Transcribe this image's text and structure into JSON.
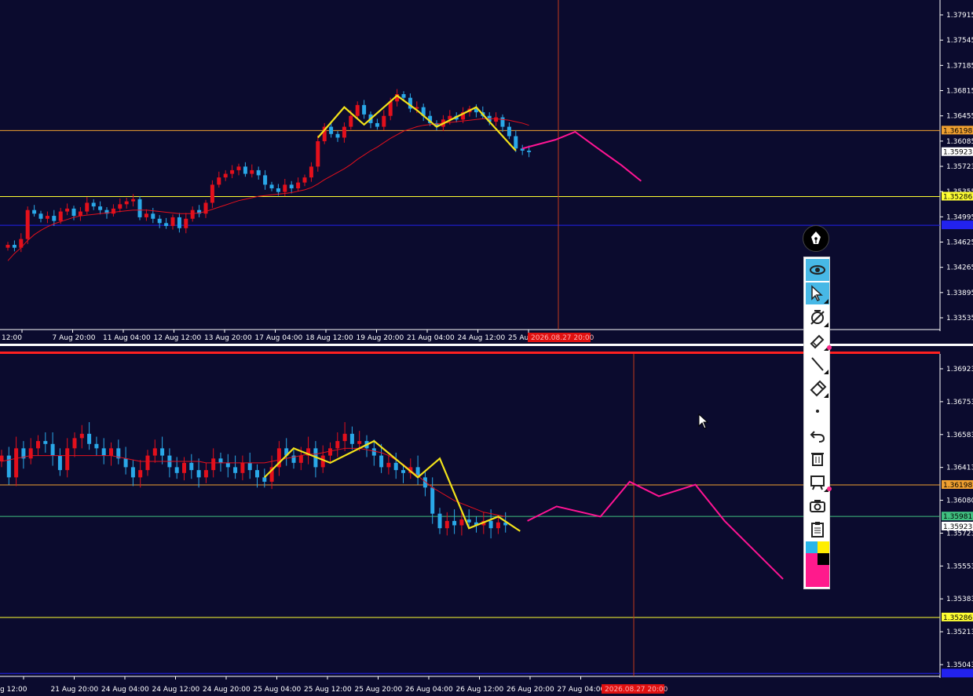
{
  "theme": {
    "background": "#0b0b2e",
    "bull_color": "#e3101c",
    "bear_color": "#2aa8e8",
    "ma_color": "#e3101c",
    "zigzag_color": "#f2e21a",
    "projection_color": "#ff1493",
    "hline_orange": "#f0a030",
    "hline_yellow": "#ffff33",
    "hline_blue": "#2222ee",
    "hline_green": "#40c080",
    "crosshair_color": "#c23a1a"
  },
  "chart_data": [
    {
      "type": "candlestick",
      "title": "",
      "x_tick_labels": [
        "12:00",
        "7 Aug 20:00",
        "11 Aug 04:00",
        "12 Aug 12:00",
        "13 Aug 20:00",
        "17 Aug 04:00",
        "18 Aug 12:00",
        "19 Aug 20:00",
        "21 Aug 04:00",
        "24 Aug 12:00",
        "25 Aug 20:00"
      ],
      "cursor_time_label": "2026.08.27 20:00",
      "y_tick_labels": [
        "1.37915",
        "1.37545",
        "1.37185",
        "1.36815",
        "1.36455",
        "1.36085",
        "1.35723",
        "1.35355",
        "1.34995",
        "1.34625",
        "1.34265",
        "1.33895",
        "1.33535"
      ],
      "ylim": [
        1.3345,
        1.38
      ],
      "horizontal_lines": [
        {
          "price": 1.36198,
          "label": "1.36198",
          "style": "orange"
        },
        {
          "price": 1.35286,
          "label": "1.35286",
          "style": "yellow"
        },
        {
          "price": 1.3489,
          "label": "",
          "style": "blue"
        }
      ],
      "current_price_label": "1.35923",
      "current_price": 1.35923,
      "closes": [
        1.3462,
        1.3458,
        1.347,
        1.351,
        1.3505,
        1.3498,
        1.3502,
        1.3495,
        1.3508,
        1.3512,
        1.3502,
        1.3508,
        1.352,
        1.3515,
        1.351,
        1.3505,
        1.3512,
        1.3518,
        1.3522,
        1.3525,
        1.35,
        1.3505,
        1.3498,
        1.3492,
        1.3488,
        1.35,
        1.3485,
        1.3498,
        1.351,
        1.3505,
        1.352,
        1.3545,
        1.3555,
        1.356,
        1.3565,
        1.357,
        1.356,
        1.3565,
        1.3558,
        1.3545,
        1.354,
        1.3535,
        1.3545,
        1.354,
        1.3548,
        1.3555,
        1.357,
        1.3605,
        1.3625,
        1.3615,
        1.361,
        1.3625,
        1.364,
        1.3655,
        1.3642,
        1.363,
        1.3625,
        1.364,
        1.366,
        1.367,
        1.3665,
        1.365,
        1.3652,
        1.364,
        1.363,
        1.3625,
        1.3635,
        1.364,
        1.3635,
        1.3645,
        1.365,
        1.3645,
        1.364,
        1.3632,
        1.3638,
        1.3625,
        1.3612,
        1.3595,
        1.3592,
        1.359
      ],
      "ma": [
        1.344,
        1.345,
        1.3458,
        1.3468,
        1.3476,
        1.3482,
        1.3487,
        1.3491,
        1.3494,
        1.3497,
        1.35,
        1.3502,
        1.3503,
        1.3504,
        1.3505,
        1.3506,
        1.3507,
        1.3508,
        1.3509,
        1.351,
        1.351,
        1.351,
        1.3509,
        1.3508,
        1.3507,
        1.3506,
        1.3505,
        1.3505,
        1.3505,
        1.3506,
        1.3508,
        1.3511,
        1.3514,
        1.3517,
        1.352,
        1.3523,
        1.3525,
        1.3527,
        1.3529,
        1.353,
        1.3531,
        1.3532,
        1.3533,
        1.3534,
        1.3536,
        1.3538,
        1.3541,
        1.3546,
        1.3552,
        1.3557,
        1.3562,
        1.3567,
        1.3573,
        1.358,
        1.3586,
        1.3592,
        1.3597,
        1.3603,
        1.3609,
        1.3614,
        1.3619,
        1.3622,
        1.3625,
        1.3627,
        1.3628,
        1.3629,
        1.363,
        1.3631,
        1.3632,
        1.3633,
        1.3634,
        1.3635,
        1.3636,
        1.3636,
        1.3636,
        1.3635,
        1.3634,
        1.3632,
        1.363,
        1.3627
      ],
      "zigzag": [
        [
          47,
          1.361
        ],
        [
          51,
          1.3652
        ],
        [
          54,
          1.3628
        ],
        [
          59,
          1.3668
        ],
        [
          62,
          1.3648
        ],
        [
          65,
          1.3625
        ],
        [
          71,
          1.3652
        ],
        [
          77,
          1.3592
        ]
      ],
      "projection": [
        [
          78,
          1.3595
        ],
        [
          83,
          1.3607
        ],
        [
          86,
          1.3618
        ],
        [
          89,
          1.3598
        ],
        [
          93,
          1.3572
        ],
        [
          96,
          1.355
        ]
      ]
    },
    {
      "type": "candlestick",
      "title": "",
      "x_tick_labels": [
        "g 12:00",
        "21 Aug 20:00",
        "24 Aug 04:00",
        "24 Aug 12:00",
        "24 Aug 20:00",
        "25 Aug 04:00",
        "25 Aug 12:00",
        "25 Aug 20:00",
        "26 Aug 04:00",
        "26 Aug 12:00",
        "26 Aug 20:00",
        "27 Aug 04:00"
      ],
      "cursor_time_label": "2026.08.27 20:00",
      "y_tick_labels": [
        "1.36923",
        "1.36753",
        "1.36583",
        "1.36413",
        "1.36080",
        "1.35723",
        "1.35553",
        "1.35383",
        "1.35213",
        "1.35043"
      ],
      "ylim": [
        1.3488,
        1.371
      ],
      "horizontal_lines": [
        {
          "price": 1.36198,
          "label": "1.36198",
          "style": "orange"
        },
        {
          "price": 1.35981,
          "label": "1.35981",
          "style": "green"
        },
        {
          "price": 1.35286,
          "label": "1.35286",
          "style": "yellow"
        },
        {
          "price": 1.349,
          "label": "",
          "style": "blue"
        }
      ],
      "current_price_label": "1.35923",
      "current_price": 1.35923,
      "closes": [
        1.364,
        1.3625,
        1.3645,
        1.3638,
        1.3645,
        1.365,
        1.3648,
        1.364,
        1.363,
        1.3645,
        1.3652,
        1.3655,
        1.3648,
        1.3645,
        1.364,
        1.3645,
        1.3638,
        1.3632,
        1.3625,
        1.363,
        1.364,
        1.3645,
        1.364,
        1.3632,
        1.3628,
        1.3635,
        1.363,
        1.3625,
        1.363,
        1.3638,
        1.3635,
        1.3632,
        1.3628,
        1.3635,
        1.363,
        1.3625,
        1.3622,
        1.3632,
        1.3645,
        1.364,
        1.3635,
        1.364,
        1.3645,
        1.3632,
        1.364,
        1.3645,
        1.365,
        1.3655,
        1.3648,
        1.365,
        1.3645,
        1.364,
        1.3632,
        1.3635,
        1.363,
        1.3628,
        1.3632,
        1.3625,
        1.3618,
        1.36,
        1.359,
        1.3595,
        1.3592,
        1.3596,
        1.3594,
        1.3592,
        1.3595,
        1.359,
        1.3594,
        1.3592
      ],
      "ma": [
        1.3636,
        1.3637,
        1.3638,
        1.3639,
        1.364,
        1.364,
        1.364,
        1.364,
        1.364,
        1.364,
        1.364,
        1.364,
        1.364,
        1.364,
        1.364,
        1.364,
        1.3639,
        1.3638,
        1.3637,
        1.3636,
        1.3636,
        1.3636,
        1.3636,
        1.3636,
        1.3636,
        1.3636,
        1.3636,
        1.3636,
        1.3635,
        1.3635,
        1.3635,
        1.3635,
        1.3635,
        1.3635,
        1.3635,
        1.3635,
        1.3635,
        1.3636,
        1.3637,
        1.3638,
        1.3639,
        1.364,
        1.3641,
        1.3641,
        1.3642,
        1.3643,
        1.3644,
        1.3645,
        1.3645,
        1.3645,
        1.3644,
        1.3643,
        1.3642,
        1.364,
        1.3637,
        1.3634,
        1.363,
        1.3626,
        1.3622,
        1.3618,
        1.3615,
        1.3612,
        1.3609,
        1.3607,
        1.3605,
        1.3603,
        1.3601,
        1.36,
        1.3599,
        1.3598
      ],
      "zigzag": [
        [
          36,
          1.3625
        ],
        [
          40,
          1.3645
        ],
        [
          45,
          1.3635
        ],
        [
          51,
          1.365
        ],
        [
          57,
          1.3625
        ],
        [
          60,
          1.3638
        ],
        [
          64,
          1.359
        ],
        [
          68,
          1.3598
        ],
        [
          71,
          1.3588
        ]
      ],
      "projection": [
        [
          72,
          1.3595
        ],
        [
          76,
          1.3605
        ],
        [
          82,
          1.3598
        ],
        [
          86,
          1.3622
        ],
        [
          90,
          1.3612
        ],
        [
          95,
          1.362
        ],
        [
          99,
          1.3595
        ],
        [
          104,
          1.357
        ],
        [
          107,
          1.3555
        ]
      ]
    }
  ],
  "toolbar": {
    "tools": [
      {
        "name": "eye-icon",
        "label": "show"
      },
      {
        "name": "cursor-arrow-icon",
        "label": "select"
      },
      {
        "name": "hide-icon",
        "label": "hide"
      },
      {
        "name": "highlighter-icon",
        "label": "highlighter"
      },
      {
        "name": "line-icon",
        "label": "line"
      },
      {
        "name": "eraser-icon",
        "label": "eraser"
      },
      {
        "name": "dot-icon",
        "label": "dot"
      },
      {
        "name": "undo-icon",
        "label": "undo"
      },
      {
        "name": "trash-icon",
        "label": "delete"
      },
      {
        "name": "projector-icon",
        "label": "board"
      },
      {
        "name": "camera-icon",
        "label": "screenshot"
      },
      {
        "name": "clipboard-icon",
        "label": "clipboard"
      }
    ],
    "palette": [
      "#27b5e9",
      "#ffee00",
      "#ff1a8c",
      "#000000"
    ],
    "selected_color": "#ff1a8c"
  }
}
